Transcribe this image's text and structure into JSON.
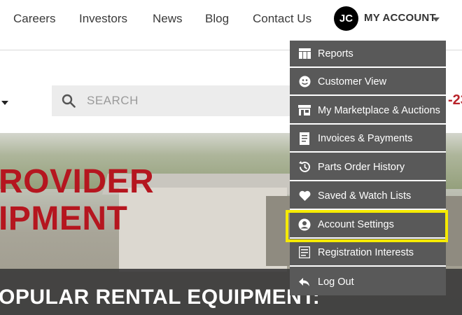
{
  "nav": {
    "links": [
      "Careers",
      "Investors",
      "News",
      "Blog",
      "Contact Us"
    ],
    "avatar_initials": "JC",
    "account_label": "MY ACCOUNT"
  },
  "search": {
    "placeholder": "SEARCH"
  },
  "phone_fragment": "-23",
  "hero": {
    "title_line1": "ROVIDER",
    "title_line2": "IPMENT",
    "subtitle": "OPULAR RENTAL EQUIPMENT:"
  },
  "account_menu": {
    "items": [
      {
        "label": "Reports",
        "icon": "reports-icon"
      },
      {
        "label": "Customer View",
        "icon": "customer-view-icon"
      },
      {
        "label": "My Marketplace & Auctions",
        "icon": "storefront-icon"
      },
      {
        "label": "Invoices & Payments",
        "icon": "invoice-icon"
      },
      {
        "label": "Parts Order History",
        "icon": "history-icon"
      },
      {
        "label": "Saved & Watch Lists",
        "icon": "heart-icon"
      },
      {
        "label": "Account Settings",
        "icon": "user-circle-icon"
      },
      {
        "label": "Registration Interests",
        "icon": "registration-icon"
      },
      {
        "label": "Log Out",
        "icon": "logout-icon"
      }
    ],
    "highlighted_item": "Account Settings"
  },
  "colors": {
    "brand_red": "#b5161f",
    "menu_bg": "#595959",
    "highlight": "#f6ea00"
  }
}
